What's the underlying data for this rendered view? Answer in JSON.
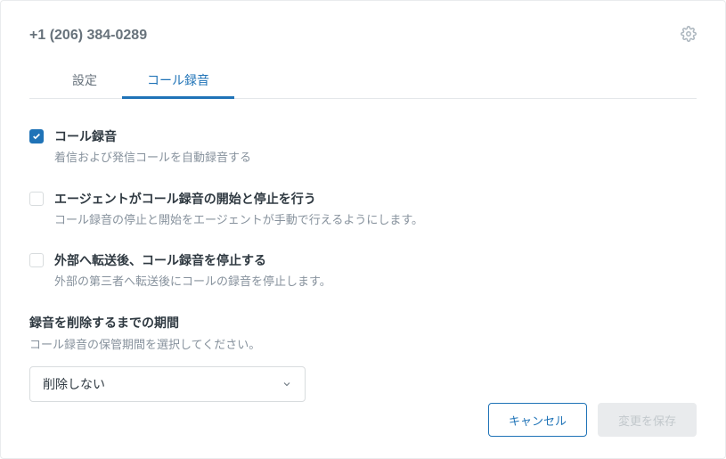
{
  "header": {
    "phone_number": "+1 (206) 384-0289"
  },
  "tabs": {
    "settings": "設定",
    "recording": "コール録音"
  },
  "options": {
    "call_recording": {
      "title": "コール録音",
      "desc": "着信および発信コールを自動録音する",
      "checked": true
    },
    "agent_control": {
      "title": "エージェントがコール録音の開始と停止を行う",
      "desc": "コール録音の停止と開始をエージェントが手動で行えるようにします。",
      "checked": false
    },
    "stop_after_transfer": {
      "title": "外部へ転送後、コール録音を停止する",
      "desc": "外部の第三者へ転送後にコールの録音を停止します。",
      "checked": false
    }
  },
  "retention": {
    "title": "録音を削除するまでの期間",
    "desc": "コール録音の保管期間を選択してください。",
    "value": "削除しない"
  },
  "buttons": {
    "cancel": "キャンセル",
    "save": "変更を保存"
  }
}
